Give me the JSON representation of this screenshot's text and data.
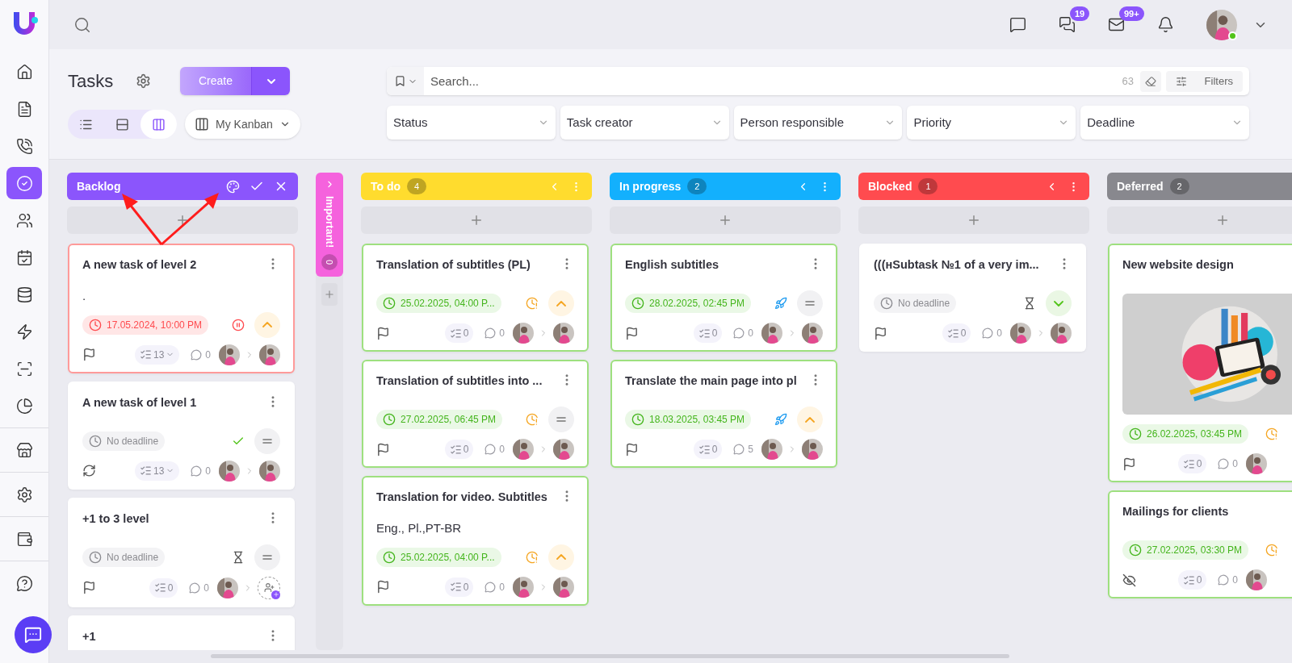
{
  "sidebar": {
    "groups": [
      [
        {
          "kind": "home",
          "selected": false
        },
        {
          "kind": "document",
          "selected": false
        },
        {
          "kind": "phone",
          "selected": false
        },
        {
          "kind": "tasks",
          "selected": true
        },
        {
          "kind": "users",
          "selected": false
        },
        {
          "kind": "calendar",
          "selected": false
        },
        {
          "kind": "database",
          "selected": false
        },
        {
          "kind": "lightning",
          "selected": false
        },
        {
          "kind": "scan",
          "selected": false
        },
        {
          "kind": "chart",
          "selected": false
        }
      ],
      [
        {
          "kind": "store",
          "selected": false
        }
      ],
      [
        {
          "kind": "settings",
          "selected": false
        }
      ],
      [
        {
          "kind": "wallet",
          "selected": false
        }
      ],
      [
        {
          "kind": "help",
          "selected": false
        }
      ]
    ]
  },
  "topbar": {
    "icons": [
      {
        "kind": "chat"
      },
      {
        "kind": "chats",
        "badge": "19"
      },
      {
        "kind": "mail",
        "badge": "99+"
      },
      {
        "kind": "bell"
      }
    ],
    "user_online": true
  },
  "header": {
    "title": "Tasks",
    "create_button": "Create",
    "views": [
      {
        "kind": "list",
        "selected": false
      },
      {
        "kind": "rows",
        "selected": false
      },
      {
        "kind": "kanban",
        "selected": true
      }
    ],
    "board_select": "My Kanban"
  },
  "search": {
    "placeholder": "Search...",
    "count": "63",
    "filters_button": "Filters"
  },
  "filters": [
    "Status",
    "Task creator",
    "Person responsible",
    "Priority",
    "Deadline"
  ],
  "columns": [
    {
      "title": "Backlog",
      "color": "#8b55fc",
      "kind": "editing",
      "cards": [
        {
          "title": "A new task of level 2",
          "description": ".",
          "deadline": {
            "text": "17.05.2024, 10:00 PM",
            "kind": "overdue"
          },
          "status": {
            "kind": "paused"
          },
          "priority": {
            "kind": "high"
          },
          "marker": {
            "kind": "flag"
          },
          "subtasks": "13",
          "subtasks_expandable": true,
          "comments": "0",
          "assignee": {
            "kind": "person"
          }
        },
        {
          "title": "A new task of level 1",
          "deadline": {
            "text": "No deadline",
            "kind": "none"
          },
          "status": {
            "kind": "done"
          },
          "priority": {
            "kind": "medium"
          },
          "marker": {
            "kind": "repeat"
          },
          "subtasks": "13",
          "subtasks_expandable": true,
          "comments": "0",
          "assignee": {
            "kind": "person"
          }
        },
        {
          "title": "+1 to 3 level",
          "deadline": {
            "text": "No deadline",
            "kind": "none"
          },
          "status": {
            "kind": "waiting"
          },
          "priority": {
            "kind": "medium"
          },
          "marker": {
            "kind": "flag"
          },
          "subtasks": "0",
          "subtasks_expandable": false,
          "comments": "0",
          "assignee": {
            "kind": "add"
          }
        },
        {
          "title": "+1"
        }
      ]
    },
    {
      "title": "Important!",
      "count": "0",
      "color": "#f562dd",
      "kind": "collapsed"
    },
    {
      "title": "To do",
      "count": "4",
      "color": "#ffdc2e",
      "kind": "normal",
      "cards": [
        {
          "title": "Translation of subtitles (PL)",
          "deadline": {
            "text": "25.02.2025, 04:00 P...",
            "kind": "upcoming"
          },
          "status": {
            "kind": "late"
          },
          "priority": {
            "kind": "high"
          },
          "marker": {
            "kind": "flag"
          },
          "subtasks": "0",
          "subtasks_expandable": false,
          "comments": "0",
          "assignee": {
            "kind": "person"
          }
        },
        {
          "title": "Translation of subtitles into ...",
          "deadline": {
            "text": "27.02.2025, 06:45 PM",
            "kind": "upcoming"
          },
          "status": {
            "kind": "late"
          },
          "priority": {
            "kind": "medium"
          },
          "marker": {
            "kind": "flag"
          },
          "subtasks": "0",
          "subtasks_expandable": false,
          "comments": "0",
          "assignee": {
            "kind": "person"
          }
        },
        {
          "title": "Translation for video. Subtitles",
          "description": "Eng., Pl.,PT-BR",
          "deadline": {
            "text": "25.02.2025, 04:00 P...",
            "kind": "upcoming"
          },
          "status": {
            "kind": "late"
          },
          "priority": {
            "kind": "high"
          },
          "marker": {
            "kind": "flag"
          },
          "subtasks": "0",
          "subtasks_expandable": false,
          "comments": "0",
          "assignee": {
            "kind": "person"
          }
        }
      ]
    },
    {
      "title": "In progress",
      "count": "2",
      "color": "#13b0fd",
      "kind": "normal",
      "cards": [
        {
          "title": "English subtitles",
          "deadline": {
            "text": "28.02.2025, 02:45 PM",
            "kind": "upcoming"
          },
          "status": {
            "kind": "started"
          },
          "priority": {
            "kind": "medium"
          },
          "marker": {
            "kind": "flag"
          },
          "subtasks": "0",
          "subtasks_expandable": false,
          "comments": "0",
          "assignee": {
            "kind": "person"
          }
        },
        {
          "title": "Translate the main page into pl",
          "deadline": {
            "text": "18.03.2025, 03:45 PM",
            "kind": "upcoming"
          },
          "status": {
            "kind": "started"
          },
          "priority": {
            "kind": "high"
          },
          "marker": {
            "kind": "flag"
          },
          "subtasks": "0",
          "subtasks_expandable": false,
          "comments": "5",
          "assignee": {
            "kind": "person"
          }
        }
      ]
    },
    {
      "title": "Blocked",
      "count": "1",
      "color": "#ff4b4f",
      "kind": "normal",
      "cards": [
        {
          "title": "(((нSubtask №1 of a very im...",
          "deadline": {
            "text": "No deadline",
            "kind": "none"
          },
          "status": {
            "kind": "waiting"
          },
          "priority": {
            "kind": "low"
          },
          "marker": {
            "kind": "flag"
          },
          "subtasks": "0",
          "subtasks_expandable": false,
          "comments": "0",
          "assignee": {
            "kind": "person"
          }
        }
      ]
    },
    {
      "title": "Deferred",
      "count": "2",
      "color": "#88888e",
      "kind": "clipped",
      "cards": [
        {
          "title": "New website design",
          "deadline": {
            "text": "26.02.2025, 03:45 PM",
            "kind": "upcoming"
          },
          "status": {
            "kind": "late"
          },
          "marker": {
            "kind": "flag"
          },
          "subtasks": "0",
          "subtasks_expandable": false,
          "comments": "0"
        },
        {
          "title": "Mailings for clients",
          "deadline": {
            "text": "27.02.2025, 03:30 PM",
            "kind": "upcoming"
          },
          "status": {
            "kind": "late"
          },
          "marker": {
            "kind": "hidden"
          },
          "subtasks": "0",
          "subtasks_expandable": false,
          "comments": "0"
        }
      ]
    }
  ]
}
